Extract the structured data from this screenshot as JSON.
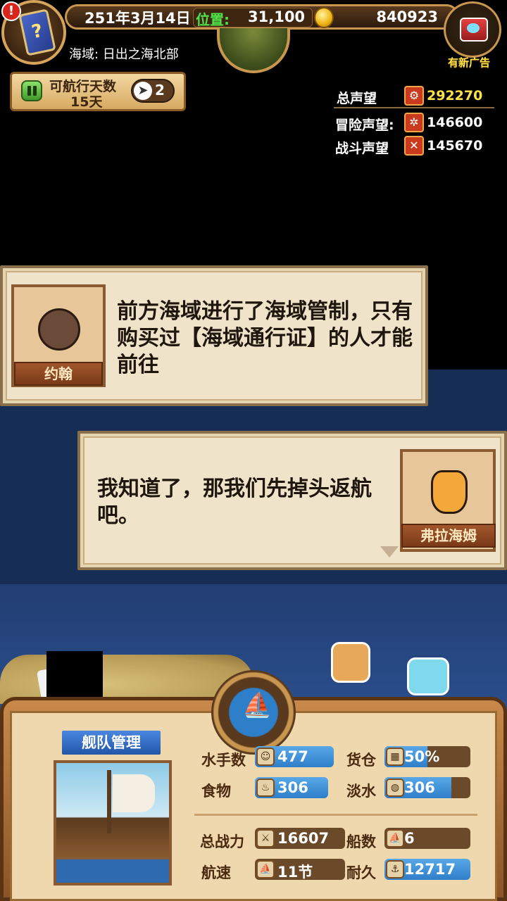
{
  "hud": {
    "date": "251年3月14日",
    "position_label": "位置:",
    "position_value": "31,100",
    "gold": "840923",
    "sea_area": "海域: 日出之海北部",
    "ad_label": "有新广告",
    "alert": "!",
    "book_icon": "book-icon",
    "chest_icon": "treasure-chest-icon"
  },
  "voyage": {
    "days_label": "可航行天数",
    "days_value": "15天",
    "cursor_count": "2"
  },
  "reputation": {
    "total_label": "总声望",
    "total_value": "292270",
    "adventure_label": "冒险声望:",
    "adventure_value": "146600",
    "battle_label": "战斗声望",
    "battle_value": "145670"
  },
  "dialog1": {
    "speaker": "约翰",
    "text": "前方海域进行了海域管制，只有购买过【海域通行证】的人才能前往"
  },
  "dialog2": {
    "speaker": "弗拉海姆",
    "text": "我知道了，那我们先掉头返航吧。"
  },
  "fleet": {
    "title": "舰队管理",
    "sailors_label": "水手数",
    "sailors_value": "477",
    "cargo_label": "货仓",
    "cargo_value": "50%",
    "cargo_fill": 0.5,
    "food_label": "食物",
    "food_value": "306",
    "water_label": "淡水",
    "water_value": "306",
    "power_label": "总战力",
    "power_value": "16607",
    "ships_label": "船数",
    "ships_value": "6",
    "speed_label": "航速",
    "speed_value": "11节",
    "durability_label": "耐久",
    "durability_value": "12717"
  },
  "colors": {
    "accent_gold": "#ffe14a",
    "position_green": "#4ee34b",
    "bar_blue": "#2e7fc9"
  }
}
